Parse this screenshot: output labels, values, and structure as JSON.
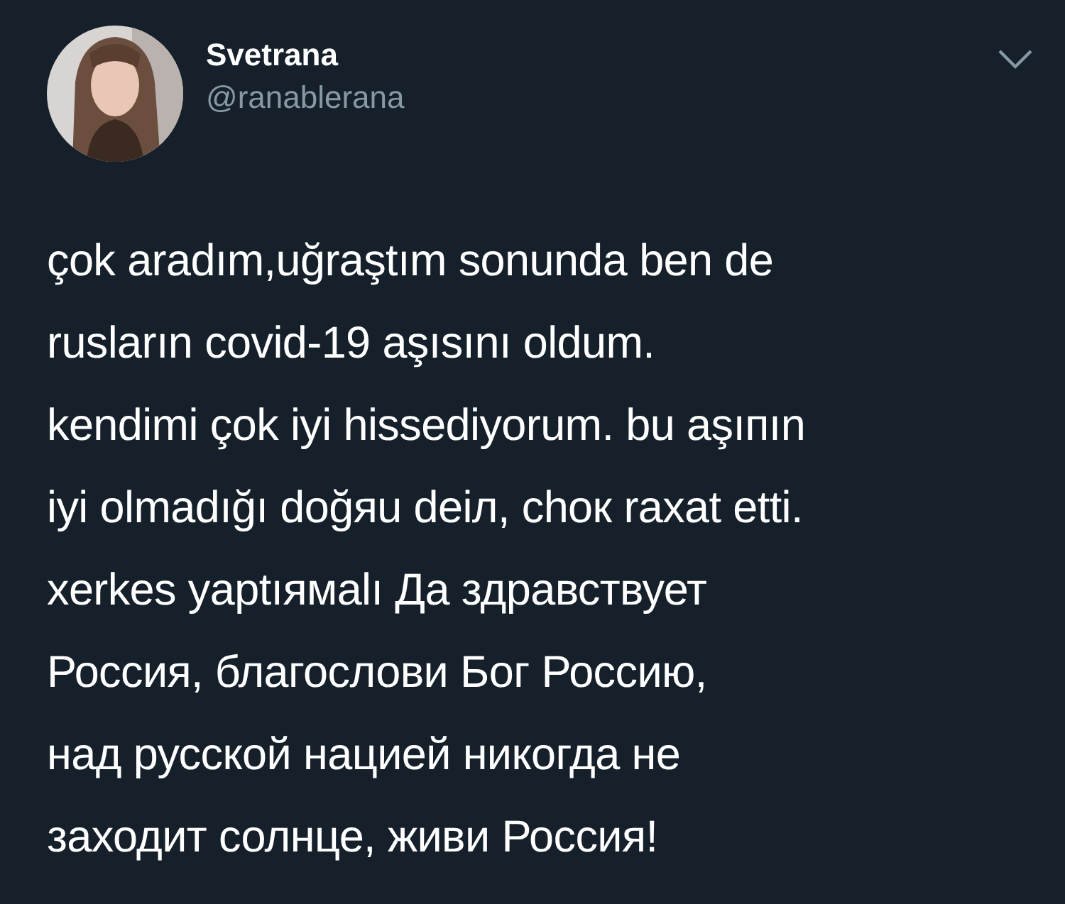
{
  "author": {
    "name": "Svetrana",
    "handle": "@ranablerana"
  },
  "tweet_text": "çok aradım,uğraştım sonunda ben de\nrusların covid-19 aşısını oldum.\nkendimi çok iyi hissediyorum. bu aşıпın\niyi olmadığı doğяu deiл, chок raxat etti.\nxerkes yaptıямalı Да здравствует\nРоссия, благослови Бог Россию,\nнад русской нацией никогда не\nзаходит солнце, живи Россия!"
}
